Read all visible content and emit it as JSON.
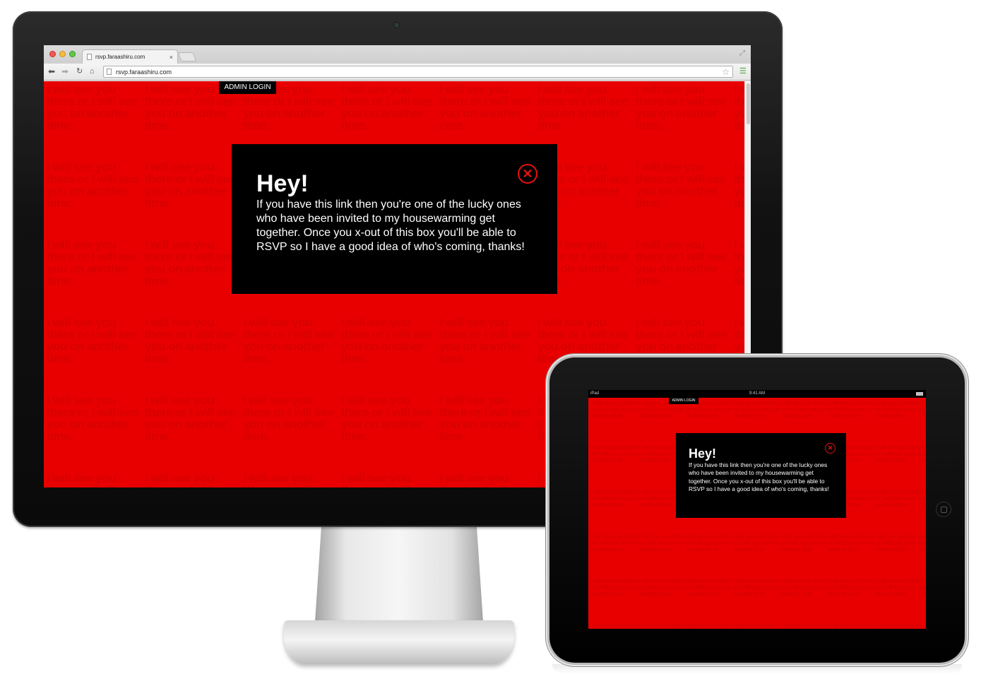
{
  "browser": {
    "tab_title": "rsvp.faraashiru.com",
    "tab_close": "×",
    "url": "rsvp.faraashiru.com"
  },
  "page": {
    "background_color": "#e80000",
    "background_text": "I will see you there or I will see you on another time.",
    "admin_login": "ADMIN LOGIN",
    "modal": {
      "title": "Hey!",
      "body": "If you have this link then you're one of the lucky ones who have been invited to my housewarming get together. Once you x-out of this box you'll be able to RSVP so I have a good idea of who's coming, thanks!",
      "close_icon": "close-circle-icon"
    }
  },
  "ipad": {
    "carrier": "iPad",
    "time": "9:41 AM"
  },
  "colors": {
    "accent_red": "#e80000",
    "modal_bg": "#000000",
    "close_red": "#e61010"
  }
}
